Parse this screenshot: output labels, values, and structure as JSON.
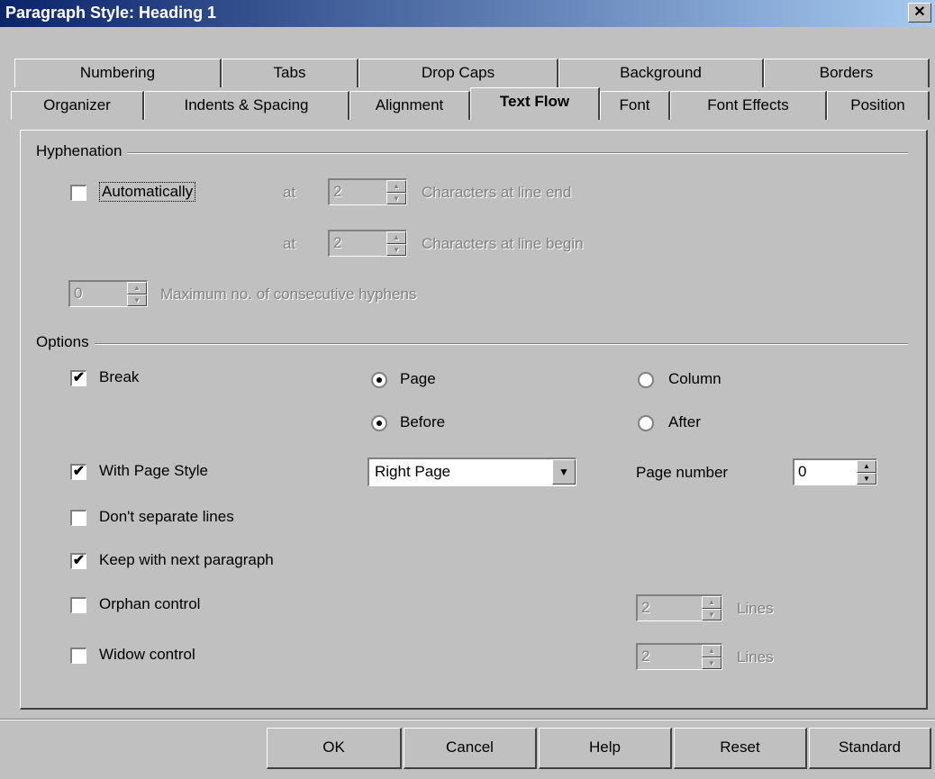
{
  "window": {
    "title": "Paragraph Style: Heading 1",
    "close_label": "✕"
  },
  "tabs_back": [
    "Numbering",
    "Tabs",
    "Drop Caps",
    "Background",
    "Borders"
  ],
  "tabs_front": [
    "Organizer",
    "Indents & Spacing",
    "Alignment",
    "Text Flow",
    "Font",
    "Font Effects",
    "Position"
  ],
  "active_tab": "Text Flow",
  "hyphenation": {
    "group_label": "Hyphenation",
    "automatically": {
      "label": "Automatically",
      "checked": false
    },
    "at1": {
      "label": "at",
      "value": "2",
      "suffix": "Characters at line end"
    },
    "at2": {
      "label": "at",
      "value": "2",
      "suffix": "Characters at line begin"
    },
    "max": {
      "value": "0",
      "label": "Maximum no. of consecutive hyphens"
    }
  },
  "options": {
    "group_label": "Options",
    "break": {
      "label": "Break",
      "checked": true
    },
    "page": {
      "label": "Page",
      "selected": true
    },
    "column": {
      "label": "Column",
      "selected": false
    },
    "before": {
      "label": "Before",
      "selected": true
    },
    "after": {
      "label": "After",
      "selected": false
    },
    "with_page_style": {
      "label": "With Page Style",
      "checked": true
    },
    "page_style_value": "Right Page",
    "page_number_label": "Page number",
    "page_number_value": "0",
    "dont_separate": {
      "label": "Don't separate lines",
      "checked": false
    },
    "keep_with_next": {
      "label": "Keep with next paragraph",
      "checked": true
    },
    "orphan": {
      "label": "Orphan control",
      "checked": false,
      "value": "2",
      "unit": "Lines"
    },
    "widow": {
      "label": "Widow control",
      "checked": false,
      "value": "2",
      "unit": "Lines"
    }
  },
  "buttons": {
    "ok": "OK",
    "cancel": "Cancel",
    "help": "Help",
    "reset": "Reset",
    "standard": "Standard"
  },
  "icons": {
    "check": "✔",
    "spin_up": "▲",
    "spin_down": "▼",
    "dropdown": "▼"
  },
  "colors": {
    "title_start": "#0a246a",
    "title_end": "#a6caf0",
    "face": "#c0c0c0"
  }
}
